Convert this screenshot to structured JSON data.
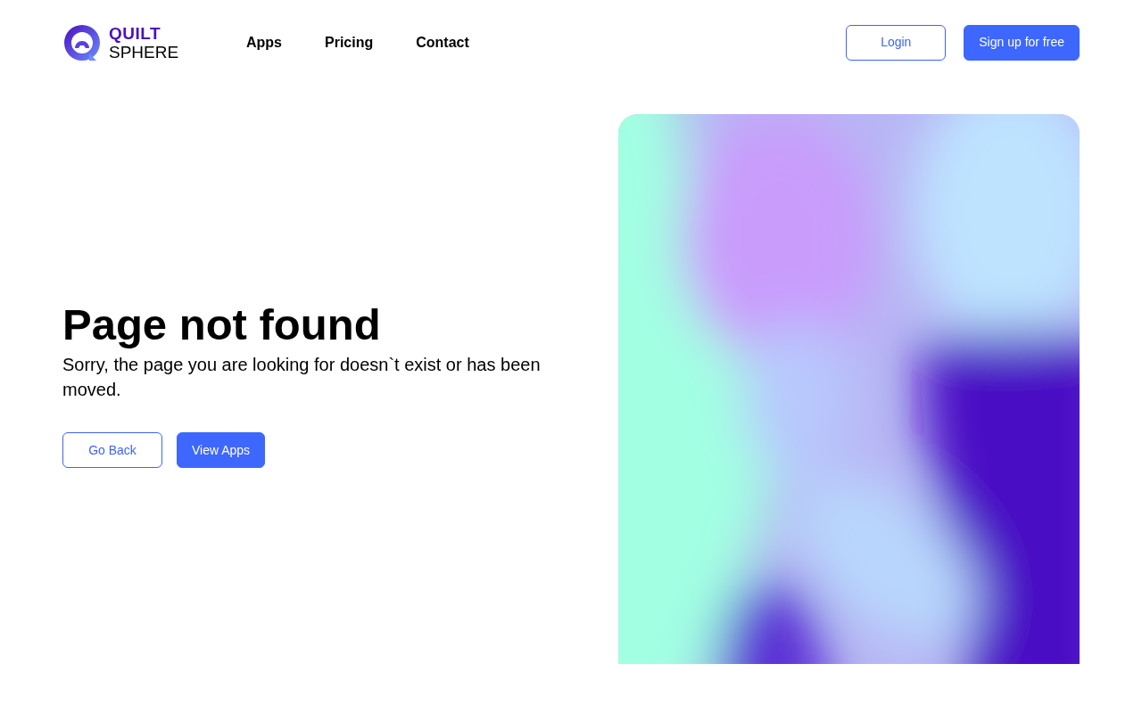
{
  "logo": {
    "line_1": "QUILT",
    "line_2": "SPHERE"
  },
  "nav": [
    {
      "label": "Apps"
    },
    {
      "label": "Pricing"
    },
    {
      "label": "Contact"
    }
  ],
  "header_buttons": [
    {
      "label": "Login",
      "kind": "outline"
    },
    {
      "label": "Sign up for free",
      "kind": "solid"
    }
  ],
  "hero": {
    "title": "Page not found",
    "message": "Sorry, the page you are looking for doesn`t exist or has been moved.",
    "buttons": [
      {
        "label": "Go Back",
        "kind": "outline"
      },
      {
        "label": "View Apps",
        "kind": "solid"
      }
    ]
  }
}
